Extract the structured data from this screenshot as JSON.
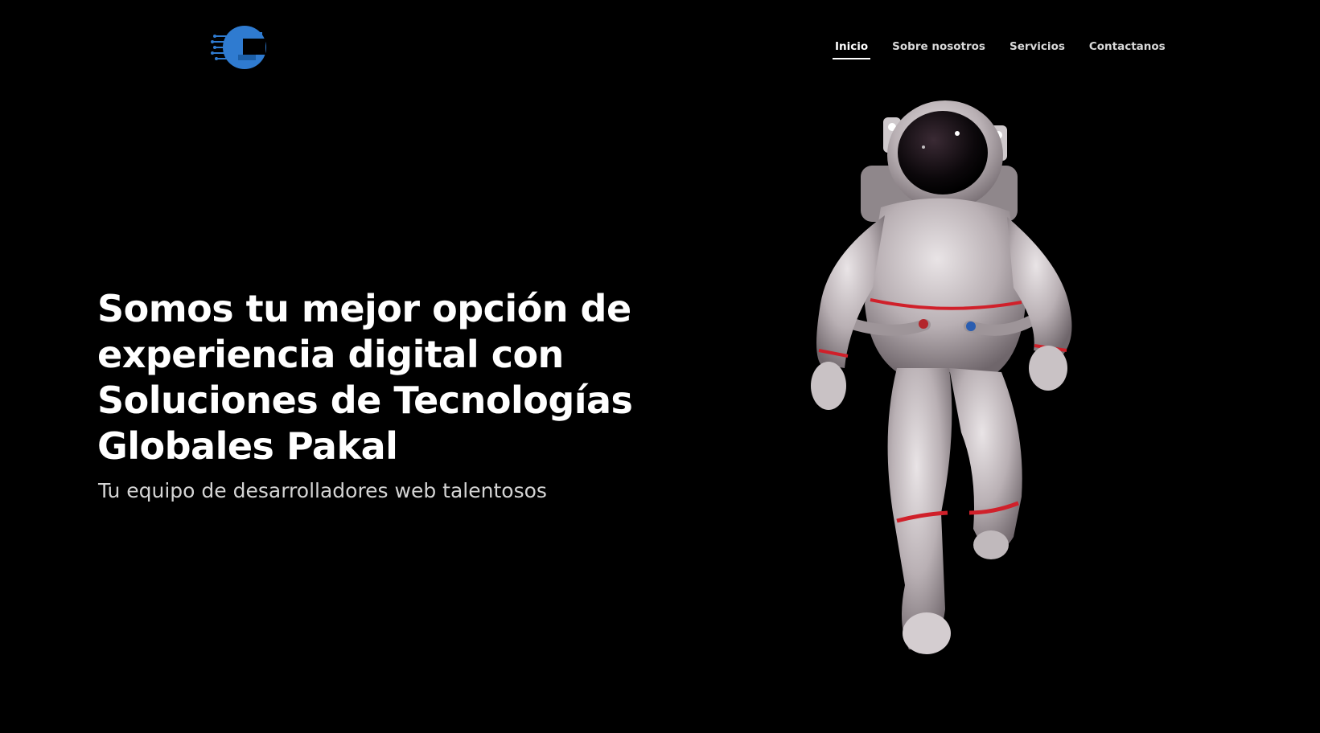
{
  "header": {
    "logo_icon": "pakal-logo-icon",
    "logo_color": "#2f7bd0",
    "nav": [
      {
        "label": "Inicio",
        "active": true
      },
      {
        "label": "Sobre nosotros",
        "active": false
      },
      {
        "label": "Servicios",
        "active": false
      },
      {
        "label": "Contactanos",
        "active": false
      }
    ]
  },
  "hero": {
    "title": "Somos tu mejor opción de experiencia digital con Soluciones de Tecnologías Globales Pakal",
    "subtitle": "Tu equipo de desarrolladores web talentosos",
    "image": "astronaut-image"
  },
  "colors": {
    "background": "#000000",
    "text": "#ffffff",
    "subtitle": "#d4d4d4",
    "accent": "#2f7bd0",
    "suit_stripe": "#d0202a"
  }
}
